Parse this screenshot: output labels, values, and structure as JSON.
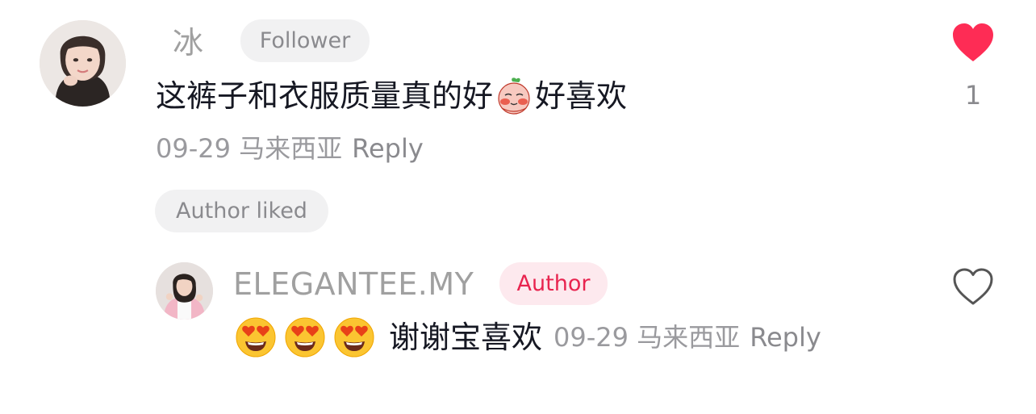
{
  "comment": {
    "user": {
      "name": "冰",
      "badge": "Follower",
      "avatar_icon": "avatar-woman-photo"
    },
    "text_before_sticker": "这裤子和衣服质量真的好",
    "sticker_icon": "blushing-peach-sticker",
    "text_after_sticker": "好喜欢",
    "date": "09-29",
    "location": "马来西亚",
    "reply_label": "Reply",
    "author_liked_label": "Author liked",
    "like": {
      "liked": true,
      "count": "1",
      "icon": "heart-filled-icon",
      "color": "#fe2c55"
    }
  },
  "reply": {
    "user": {
      "name": "ELEGANTEE.MY",
      "badge": "Author",
      "avatar_icon": "avatar-author-photo"
    },
    "emojis": [
      "heart-eyes-emoji",
      "heart-eyes-emoji",
      "heart-eyes-emoji"
    ],
    "text": "谢谢宝喜欢",
    "date": "09-29",
    "location": "马来西亚",
    "reply_label": "Reply",
    "like": {
      "liked": false,
      "icon": "heart-outline-icon"
    }
  },
  "colors": {
    "author_badge_text": "#e8244f",
    "author_badge_bg": "#fde9ee",
    "chip_bg": "#f1f1f2",
    "muted_text": "#9a9a9e",
    "body_text": "#161823"
  }
}
